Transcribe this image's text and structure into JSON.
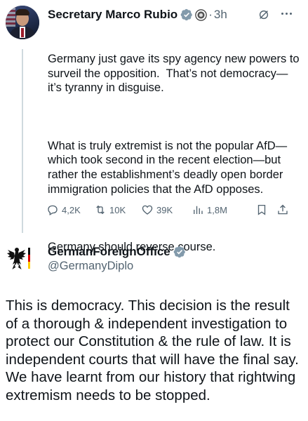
{
  "tweet1": {
    "name": "Secretary Marco Rubio",
    "time": "3h",
    "paragraphs": [
      "Germany just gave its spy agency new powers to surveil the opposition.  That’s not democracy—it’s tyranny in disguise.",
      "What is truly extremist is not the popular AfD—which took second in the recent election—but rather the establishment’s deadly open border immigration policies that the AfD opposes.",
      "Germany should reverse course."
    ],
    "stats": {
      "replies": "4,2K",
      "reposts": "10K",
      "likes": "39K",
      "views": "1,8M"
    }
  },
  "post2": {
    "name": "GermanForeignOffice",
    "handle": "@GermanyDiplo",
    "text": "This is democracy. This decision is the result of a thorough & independent investigation to protect our Constitution & the rule of law. It is independent courts that will have the final say. We have learnt from our history that rightwing extremism needs to be stopped."
  },
  "colors": {
    "verified": "#829aab",
    "muted": "#536471",
    "text": "#0f1419"
  }
}
